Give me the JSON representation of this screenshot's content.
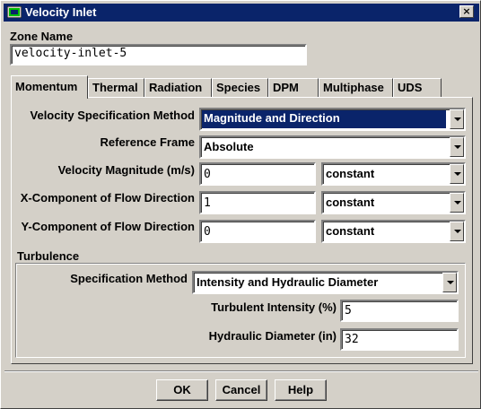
{
  "window": {
    "title": "Velocity Inlet",
    "close_label": "×"
  },
  "zone": {
    "label": "Zone Name",
    "value": "velocity-inlet-5"
  },
  "tabs": [
    {
      "label": "Momentum",
      "active": true
    },
    {
      "label": "Thermal"
    },
    {
      "label": "Radiation"
    },
    {
      "label": "Species"
    },
    {
      "label": "DPM"
    },
    {
      "label": "Multiphase"
    },
    {
      "label": "UDS"
    }
  ],
  "momentum": {
    "velocity_spec": {
      "label": "Velocity Specification Method",
      "value": "Magnitude and Direction"
    },
    "reference_frame": {
      "label": "Reference Frame",
      "value": "Absolute"
    },
    "velocity_magnitude": {
      "label": "Velocity Magnitude (m/s)",
      "value": "0",
      "profile": "constant"
    },
    "x_component": {
      "label": "X-Component of Flow Direction",
      "value": "1",
      "profile": "constant"
    },
    "y_component": {
      "label": "Y-Component of Flow Direction",
      "value": "0",
      "profile": "constant"
    }
  },
  "turbulence": {
    "heading": "Turbulence",
    "spec_method": {
      "label": "Specification Method",
      "value": "Intensity and Hydraulic Diameter"
    },
    "intensity": {
      "label": "Turbulent Intensity (%)",
      "value": "5"
    },
    "hydraulic_diameter": {
      "label": "Hydraulic Diameter (in)",
      "value": "32"
    }
  },
  "buttons": {
    "ok": "OK",
    "cancel": "Cancel",
    "help": "Help"
  }
}
